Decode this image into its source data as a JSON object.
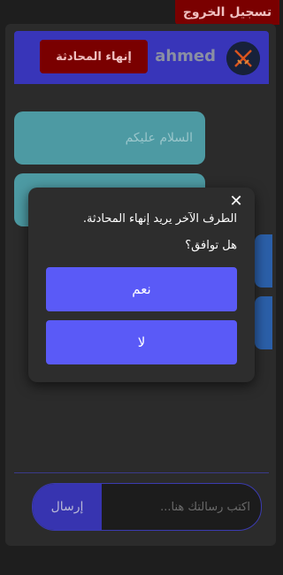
{
  "logout_label": "تسجيل الخروج",
  "header": {
    "username": "ahmed",
    "end_chat_label": "إنهاء المحادثة"
  },
  "messages": [
    {
      "text": "السلام عليكم"
    },
    {
      "text": ""
    }
  ],
  "composer": {
    "placeholder": "اكتب رسالتك هنا...",
    "send_label": "إرسال"
  },
  "modal": {
    "line1": "الطرف الآخر يريد إنهاء المحادثة.",
    "line2": "هل توافق؟",
    "yes_label": "نعم",
    "no_label": "لا",
    "close_glyph": "✕"
  },
  "colors": {
    "accent": "#5a5af7",
    "header": "#3835b9",
    "danger": "#7a0000",
    "message": "#4d9aa3",
    "background": "#1e1e1e"
  }
}
